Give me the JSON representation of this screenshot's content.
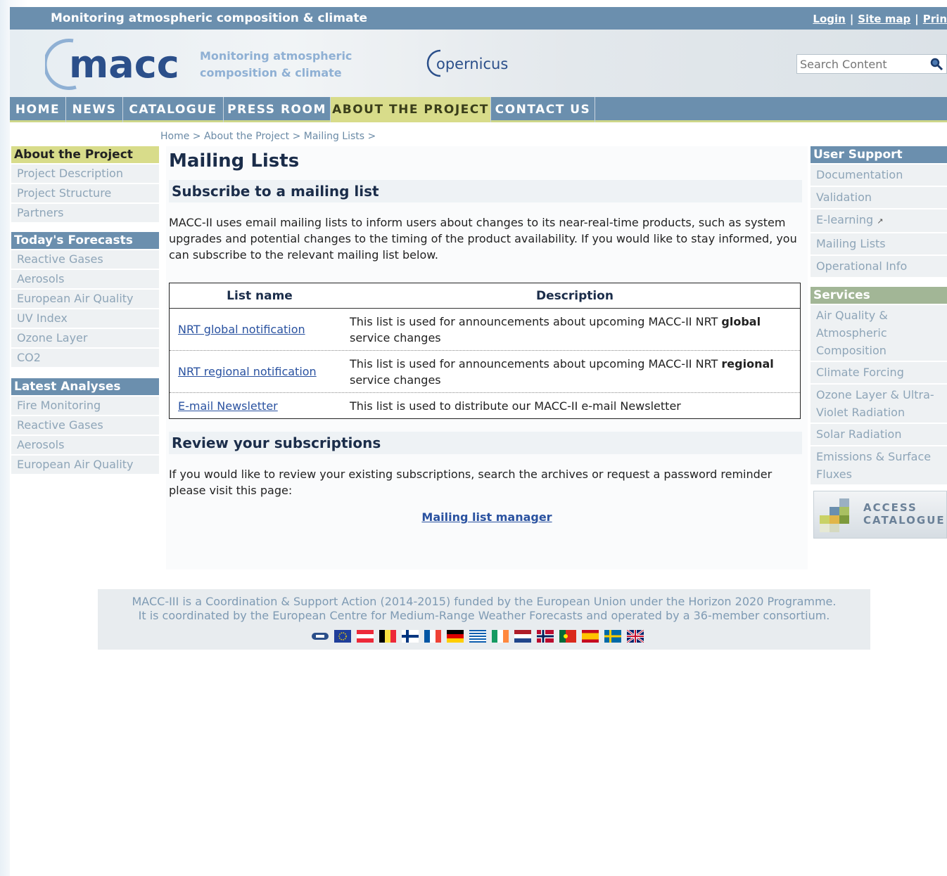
{
  "topbar": {
    "tagline": "Monitoring atmospheric composition & climate",
    "links": [
      "Login",
      "Site map",
      "Prin"
    ]
  },
  "header": {
    "logo_text": "macc",
    "logo_subtitle_line1": "Monitoring atmospheric",
    "logo_subtitle_line2": "composition & climate",
    "partner_logo": "opernicus",
    "search_placeholder": "Search Content"
  },
  "nav": {
    "items": [
      "HOME",
      "NEWS",
      "CATALOGUE",
      "PRESS ROOM",
      "ABOUT THE PROJECT",
      "CONTACT US"
    ],
    "active": "ABOUT THE PROJECT"
  },
  "breadcrumb": "Home > About the Project > Mailing Lists >",
  "left": {
    "about_title": "About the Project",
    "about_items": [
      "Project Description",
      "Project Structure",
      "Partners"
    ],
    "forecasts_title": "Today's Forecasts",
    "forecasts_items": [
      "Reactive Gases",
      "Aerosols",
      "European Air Quality",
      "UV Index",
      "Ozone Layer",
      "CO2"
    ],
    "analyses_title": "Latest Analyses",
    "analyses_items": [
      "Fire Monitoring",
      "Reactive Gases",
      "Aerosols",
      "European Air Quality"
    ]
  },
  "main": {
    "title": "Mailing Lists",
    "subscribe_heading": "Subscribe to a mailing list",
    "intro": "MACC-II uses email mailing lists to inform users about changes to its near-real-time products, such as system upgrades and potential changes to the timing of the product availability. If you would like to stay informed, you can subscribe to the relevant mailing list below.",
    "table": {
      "col_name": "List name",
      "col_desc": "Description",
      "rows": [
        {
          "name": "NRT global notification",
          "desc_pre": "This list is used for announcements about upcoming MACC-II NRT ",
          "desc_bold": "global",
          "desc_post": " service changes"
        },
        {
          "name": "NRT regional notification",
          "desc_pre": "This list is used for announcements about upcoming MACC-II NRT ",
          "desc_bold": "regional",
          "desc_post": " service changes"
        },
        {
          "name": "E-mail Newsletter",
          "desc_pre": "This list is used to distribute our MACC-II e-mail Newsletter",
          "desc_bold": "",
          "desc_post": ""
        }
      ]
    },
    "review_heading": "Review your subscriptions",
    "review_text": "If you would like to review your existing subscriptions, search the archives or request a password reminder please visit this page:",
    "manager_link": "Mailing list manager"
  },
  "right": {
    "support_title": "User Support",
    "support_items": [
      "Documentation",
      "Validation",
      "E-learning",
      "Mailing Lists",
      "Operational Info"
    ],
    "services_title": "Services",
    "services_items": [
      "Air Quality & Atmospheric Composition",
      "Climate Forcing",
      "Ozone Layer & Ultra-Violet Radiation",
      "Solar Radiation",
      "Emissions & Surface Fluxes"
    ],
    "access_line1": "ACCESS",
    "access_line2": "CATALOGUE"
  },
  "footer": {
    "line1": "MACC-III is a Coordination & Support Action (2014-2015) funded by the European Union under the Horizon 2020 Programme.",
    "line2": "It is coordinated by the European Centre for Medium-Range Weather Forecasts and operated by a 36-member consortium."
  },
  "colors": {
    "nav_blue": "#6b8fae",
    "active_tab": "#d8dc8a",
    "link": "#2a52a0",
    "heading": "#1b2d4a"
  }
}
